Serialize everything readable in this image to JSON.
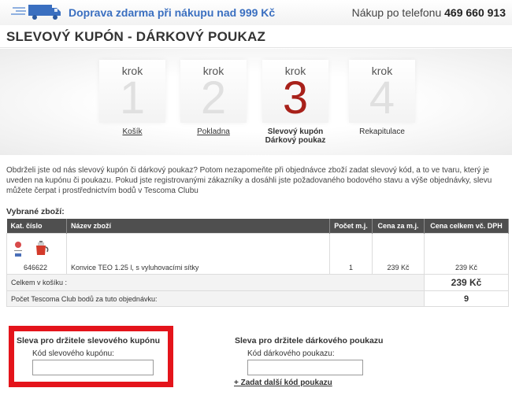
{
  "header": {
    "truck_icon": "delivery-truck-icon",
    "free_shipping": "Doprava zdarma při nákupu nad 999 Kč",
    "phone_label": "Nákup po telefonu",
    "phone_number": "469 660 913"
  },
  "page_title": "SLEVOVÝ KUPÓN - DÁRKOVÝ POUKAZ",
  "steps": [
    {
      "krok": "krok",
      "number": "1",
      "label": "Košík",
      "active": false
    },
    {
      "krok": "krok",
      "number": "2",
      "label": "Pokladna",
      "active": false
    },
    {
      "krok": "krok",
      "number": "3",
      "label_line1": "Slevový kupón",
      "label_line2": "Dárkový poukaz",
      "active": true
    },
    {
      "krok": "krok",
      "number": "4",
      "label": "Rekapitulace",
      "active": false
    }
  ],
  "intro_text": "Obdrželi jste od nás slevový kupón či dárkový poukaz? Potom nezapomeňte při objednávce zboží zadat slevový kód, a to ve tvaru, který je uveden na kupónu či poukazu. Pokud jste registrovanými zákazníky a dosáhli jste požadovaného bodového stavu a výše objednávky, slevu můžete čerpat i prostřednictvím bodů v Tescoma Clubu",
  "selected_heading": "Vybrané zboží:",
  "table": {
    "headers": [
      "Kat. číslo",
      "Název zboží",
      "Počet m.j.",
      "Cena za m.j.",
      "Cena celkem vč. DPH"
    ],
    "rows": [
      {
        "cat_no": "646622",
        "name": "Konvice TEO 1.25 l, s vyluhovacími sítky",
        "qty": "1",
        "unit_price": "239 Kč",
        "total": "239 Kč"
      }
    ],
    "cart_total_label": "Celkem v košíku :",
    "cart_total_value": "239 Kč",
    "points_label": "Počet Tescoma Club bodů za tuto objednávku:",
    "points_value": "9"
  },
  "coupon": {
    "title": "Sleva pro držitele slevového kupónu",
    "label": "Kód slevového kupónu:",
    "value": ""
  },
  "gift": {
    "title": "Sleva pro držitele dárkového poukazu",
    "label": "Kód dárkového poukazu:",
    "value": "",
    "add_link": "+ Zadat další kód poukazu"
  },
  "colors": {
    "accent_blue": "#3a6fc0",
    "active_step": "#a8211a",
    "highlight_red": "#e4141b",
    "total_red": "#c0141b"
  }
}
